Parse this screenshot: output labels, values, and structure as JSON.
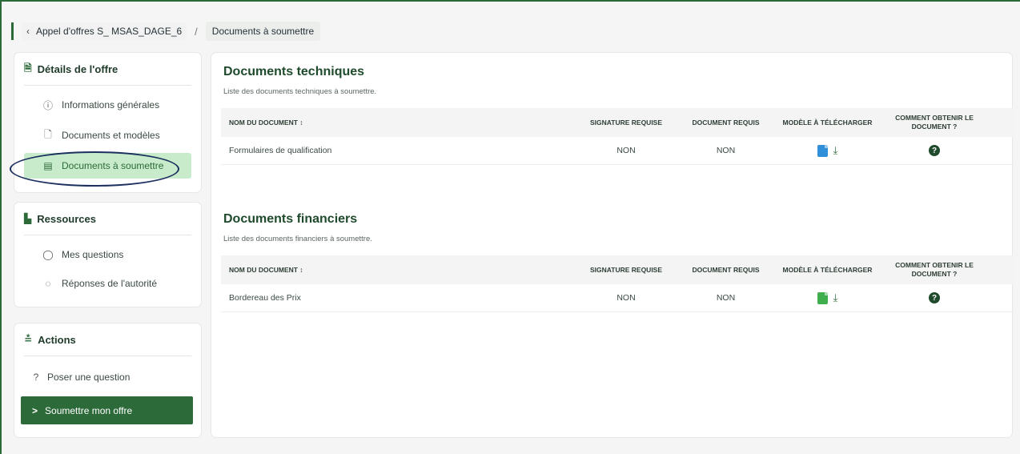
{
  "breadcrumb": {
    "back_label": "Appel d'offres S_ MSAS_DAGE_6",
    "separator": "/",
    "current": "Documents à soumettre"
  },
  "sidebar": {
    "offer_details": {
      "title": "Détails de l'offre",
      "items": [
        {
          "label": "Informations générales",
          "icon": "info-icon"
        },
        {
          "label": "Documents et modèles",
          "icon": "document-icon"
        },
        {
          "label": "Documents à soumettre",
          "icon": "documents-submit-icon",
          "active": true
        }
      ]
    },
    "resources": {
      "title": "Ressources",
      "items": [
        {
          "label": "Mes questions",
          "icon": "chat-bubble-icon"
        },
        {
          "label": "Réponses de l'autorité",
          "icon": "chat-reply-icon"
        }
      ]
    },
    "actions": {
      "title": "Actions",
      "items": [
        {
          "label": "Poser une question",
          "icon": "question-icon"
        }
      ],
      "submit_label": "Soumettre mon offre"
    }
  },
  "main": {
    "columns": {
      "name": "NOM DU DOCUMENT ↕",
      "signature": "SIGNATURE REQUISE",
      "required": "DOCUMENT REQUIS",
      "template": "MODÈLE À TÉLÉCHARGER",
      "how": "COMMENT OBTENIR LE DOCUMENT ?"
    },
    "technical": {
      "title": "Documents techniques",
      "subtitle": "Liste des documents techniques à soumettre.",
      "rows": [
        {
          "name": "Formulaires de qualification",
          "signature": "NON",
          "required": "NON",
          "file_color": "#2f8fd8"
        }
      ]
    },
    "financial": {
      "title": "Documents financiers",
      "subtitle": "Liste des documents financiers à soumettre.",
      "rows": [
        {
          "name": "Bordereau des Prix",
          "signature": "NON",
          "required": "NON",
          "file_color": "#3fae4f"
        }
      ]
    }
  },
  "colors": {
    "brand": "#2d6a3a",
    "active_bg": "#c8eccb",
    "annotation_ellipse": "#1c2f5e"
  }
}
